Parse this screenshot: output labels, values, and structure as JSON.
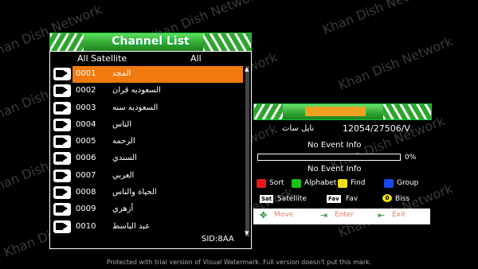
{
  "channel_list": {
    "title": "Channel List",
    "satellite_label": "All Satellite",
    "filter_label": "All",
    "sid": "SID:8AA",
    "channels": [
      {
        "num": "0001",
        "name": "المجد",
        "selected": true
      },
      {
        "num": "0002",
        "name": "السعوديه قران"
      },
      {
        "num": "0003",
        "name": "السعوديه سنه"
      },
      {
        "num": "0004",
        "name": "الناس"
      },
      {
        "num": "0005",
        "name": "الرحمه"
      },
      {
        "num": "0006",
        "name": "السندي"
      },
      {
        "num": "0007",
        "name": "العربي"
      },
      {
        "num": "0008",
        "name": "الحياة والناس"
      },
      {
        "num": "0009",
        "name": "أزهري"
      },
      {
        "num": "0010",
        "name": "عبد الباسط"
      }
    ]
  },
  "info_panel": {
    "satellite": "نايل سات",
    "transponder": "12054/27506/V",
    "event_1": "No Event Info",
    "progress_label": "0%",
    "progress_value": 0,
    "event_2": "No Event Info",
    "keys": {
      "sort": "Sort",
      "alphabet": "Alphabet",
      "find": "Find",
      "group": "Group",
      "sat_key": "Sat",
      "satellite": "Satellite",
      "fav_key": "Fav",
      "fav": "Fav",
      "zero_key": "0",
      "biss": "Biss"
    },
    "bottom": {
      "move": "Move",
      "enter": "Enter",
      "exit": "Exit"
    }
  },
  "watermark_text": "Khan Dish Network",
  "footer": "Protected with trial version of Visual Watermark. Full version doesn't put this mark.",
  "colors": {
    "selection": "#f07a10",
    "title_green": "#2fa52f",
    "key_red": "#e81818",
    "key_green": "#18c018",
    "key_yellow": "#f0e010",
    "key_blue": "#1848e8"
  }
}
